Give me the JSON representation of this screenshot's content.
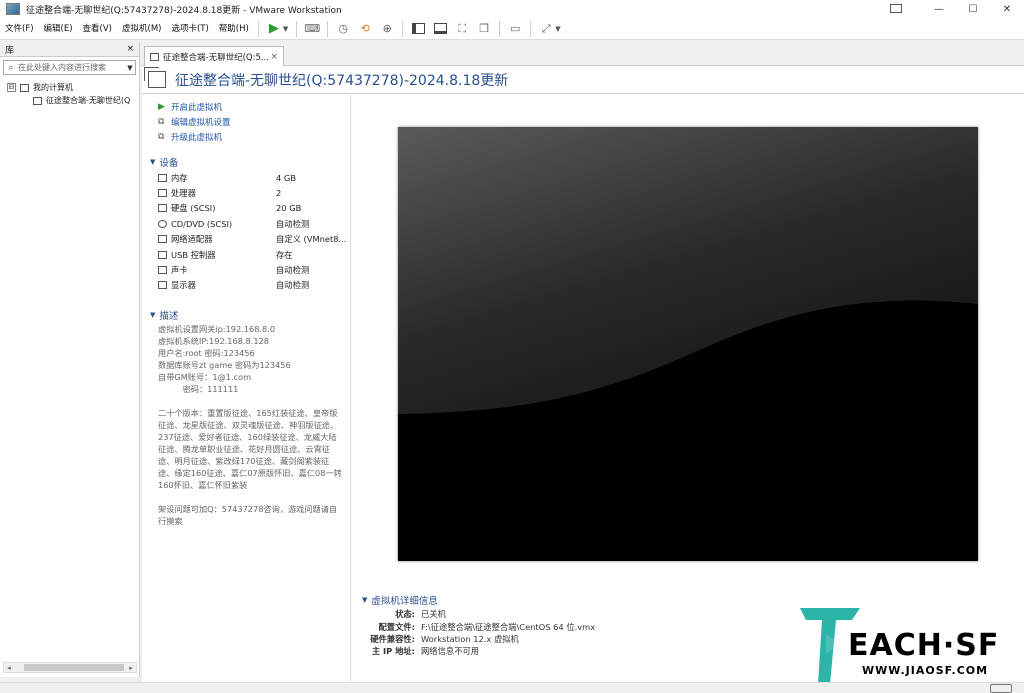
{
  "window": {
    "title": "征途整合端-无聊世纪(Q:57437278)-2024.8.18更新 - VMware Workstation",
    "minimize": "—",
    "maximize": "☐",
    "close": "✕"
  },
  "menu": {
    "items": [
      "文件(F)",
      "编辑(E)",
      "查看(V)",
      "虚拟机(M)",
      "选项卡(T)",
      "帮助(H)"
    ]
  },
  "library": {
    "title": "库",
    "close": "×",
    "search_placeholder": "在此处键入内容进行搜索",
    "tree": {
      "root_label": "我的计算机",
      "root_expander": "⊟",
      "child_label": "征途整合端-无聊世纪(Q"
    }
  },
  "tab": {
    "label": "征途整合端-无聊世纪(Q:5...",
    "close": "×"
  },
  "vm": {
    "title": "征途整合端-无聊世纪(Q:57437278)-2024.8.18更新",
    "actions": [
      {
        "label": "开启此虚拟机",
        "icon": "play-icon"
      },
      {
        "label": "编辑虚拟机设置",
        "icon": "edit-settings-icon"
      },
      {
        "label": "升级此虚拟机",
        "icon": "upgrade-icon"
      }
    ],
    "devices_heading": "设备",
    "devices": [
      {
        "name": "内存",
        "value": "4 GB",
        "icon": "memory-icon"
      },
      {
        "name": "处理器",
        "value": "2",
        "icon": "cpu-icon"
      },
      {
        "name": "硬盘 (SCSI)",
        "value": "20 GB",
        "icon": "hard-disk-icon"
      },
      {
        "name": "CD/DVD (SCSI)",
        "value": "自动检测",
        "icon": "cd-dvd-icon"
      },
      {
        "name": "网络适配器",
        "value": "自定义 (VMnet8...",
        "icon": "network-icon"
      },
      {
        "name": "USB 控制器",
        "value": "存在",
        "icon": "usb-icon"
      },
      {
        "name": "声卡",
        "value": "自动检测",
        "icon": "sound-icon"
      },
      {
        "name": "显示器",
        "value": "自动检测",
        "icon": "display-icon"
      }
    ],
    "description_heading": "描述",
    "description_lines": [
      "虚拟机设置网关ip:192.168.8.0",
      "虚拟机系统IP:192.168.8.128",
      "用户名:root 密码:123456",
      "数据库账号zt game 密码为123456",
      "自带GM账号：1@1.com",
      "　　　密码：111111",
      "",
      "二十个版本：重置版征途、165红装征途、皇帝版",
      "征途、龙星版征途、双灵魂版征途、神羽版征途、",
      "237征途、爱好者征途、160绿装征途、龙威大陆",
      "征途、腾龙单职业征途、花好月圆征途、云霄征",
      "途、明月征途、紫改绿170征途、藏剑阁紫装征",
      "途、缘定160征途、嘉仁07原版怀旧、嘉仁08一转",
      "160怀旧、嘉仁怀旧紫装",
      "",
      "架设问题可加Q：57437278咨询，游戏问题请自",
      "行摸索"
    ],
    "details_heading": "虚拟机详细信息",
    "details": [
      {
        "k": "状态:",
        "v": "已关机"
      },
      {
        "k": "配置文件:",
        "v": "F:\\征途整合端\\征途整合端\\CentOS 64 位.vmx"
      },
      {
        "k": "硬件兼容性:",
        "v": "Workstation 12.x 虚拟机"
      },
      {
        "k": "主 IP 地址:",
        "v": "网络信息不可用"
      }
    ]
  },
  "watermark": {
    "brand": "EACH·SF",
    "url": "WWW.JIAOSF.COM",
    "color": "#2bb5a8"
  }
}
